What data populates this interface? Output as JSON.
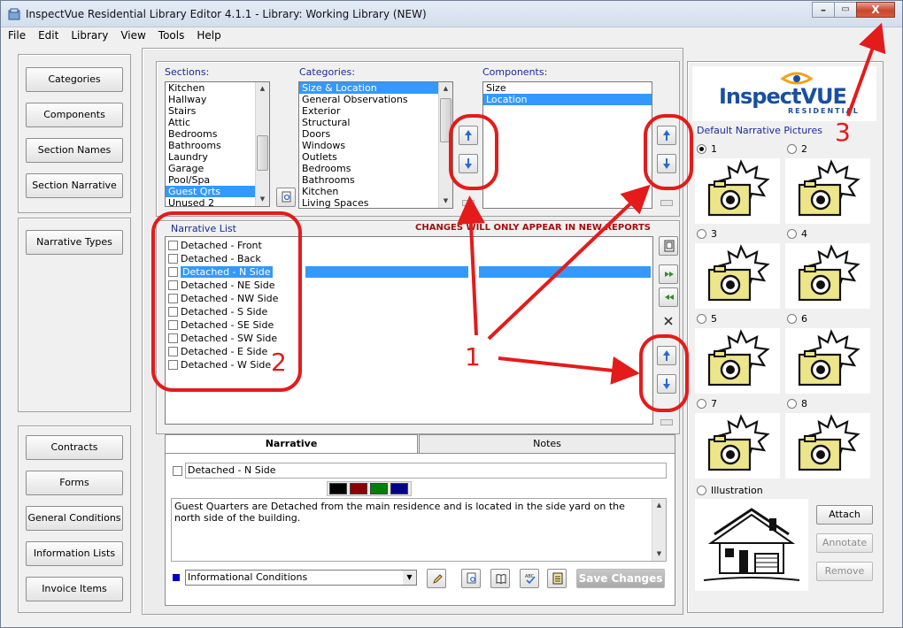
{
  "window": {
    "title": "InspectVue Residential Library Editor 4.1.1 - Library: Working Library (NEW)",
    "controls": {
      "minimize": "–",
      "maximize": "▭",
      "close": "X"
    }
  },
  "menu": [
    "File",
    "Edit",
    "Library",
    "View",
    "Tools",
    "Help"
  ],
  "left_nav": {
    "top": [
      "Categories",
      "Components",
      "Section Names",
      "Section Narrative"
    ],
    "middle": [
      "Narrative Types"
    ],
    "bottom": [
      "Contracts",
      "Forms",
      "General Conditions",
      "Information Lists",
      "Invoice Items"
    ]
  },
  "sections": {
    "label": "Sections:",
    "items": [
      "Kitchen",
      "Hallway",
      "Stairs",
      "Attic",
      "Bedrooms",
      "Bathrooms",
      "Laundry",
      "Garage",
      "Pool/Spa",
      "Guest Qrts",
      "Unused 2"
    ],
    "selected": "Guest Qrts"
  },
  "categories": {
    "label": "Categories:",
    "items": [
      "Size & Location",
      "General Observations",
      "Exterior",
      "Structural",
      "Doors",
      "Windows",
      "Outlets",
      "Bedrooms",
      "Bathrooms",
      "Kitchen",
      "Living Spaces"
    ],
    "selected": "Size & Location"
  },
  "components": {
    "label": "Components:",
    "items": [
      "Size",
      "Location"
    ],
    "selected": "Location"
  },
  "narrative_list": {
    "label": "Narrative List",
    "warning": "CHANGES WILL ONLY APPEAR IN NEW REPORTS",
    "items": [
      "Detached - Front",
      "Detached - Back",
      "Detached - N Side",
      "Detached - NE Side",
      "Detached - NW Side",
      "Detached - S Side",
      "Detached - SE Side",
      "Detached - SW Side",
      "Detached - E Side",
      "Detached - W Side"
    ],
    "selected": "Detached - N Side"
  },
  "editor": {
    "tabs": [
      "Narrative",
      "Notes"
    ],
    "active_tab": "Narrative",
    "title_value": "Detached - N Side",
    "colors": [
      "#000000",
      "#8b0000",
      "#008000",
      "#00008b"
    ],
    "body_text": "Guest Quarters are Detached from the main residence and is located in the side yard on the north side of the building.",
    "type_value": "Informational Conditions",
    "type_color": "#0000cc",
    "save_label": "Save Changes"
  },
  "pictures": {
    "logo_main": "InspectVUE",
    "logo_sub": "RESIDENTIAL",
    "label": "Default Narrative Pictures",
    "slots": [
      "1",
      "2",
      "3",
      "4",
      "5",
      "6",
      "7",
      "8"
    ],
    "selected_slot": "1",
    "illustration_label": "Illustration",
    "attach_label": "Attach",
    "annotate_label": "Annotate",
    "remove_label": "Remove"
  },
  "annotations": [
    "1",
    "2",
    "3"
  ]
}
